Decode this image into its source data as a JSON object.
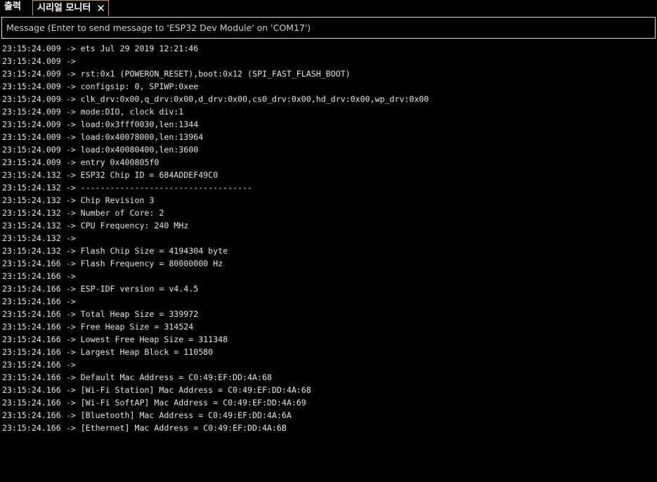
{
  "tabs": {
    "output_label": "출력",
    "serial_label": "시리얼 모니터",
    "close_glyph": "✕"
  },
  "message": {
    "placeholder": "Message (Enter to send message to 'ESP32 Dev Module' on 'COM17')"
  },
  "log_lines": [
    "23:15:24.009 -> ets Jul 29 2019 12:21:46",
    "23:15:24.009 -> ",
    "23:15:24.009 -> rst:0x1 (POWERON_RESET),boot:0x12 (SPI_FAST_FLASH_BOOT)",
    "23:15:24.009 -> configsip: 0, SPIWP:0xee",
    "23:15:24.009 -> clk_drv:0x00,q_drv:0x00,d_drv:0x00,cs0_drv:0x00,hd_drv:0x00,wp_drv:0x00",
    "23:15:24.009 -> mode:DIO, clock div:1",
    "23:15:24.009 -> load:0x3fff0030,len:1344",
    "23:15:24.009 -> load:0x40078000,len:13964",
    "23:15:24.009 -> load:0x40080400,len:3600",
    "23:15:24.009 -> entry 0x400805f0",
    "23:15:24.132 -> ESP32 Chip ID = 684ADDEF49C0",
    "23:15:24.132 -> -----------------------------------",
    "23:15:24.132 -> Chip Revision 3",
    "23:15:24.132 -> Number of Core: 2",
    "23:15:24.132 -> CPU Frequency: 240 MHz",
    "23:15:24.132 -> ",
    "23:15:24.132 -> Flash Chip Size = 4194304 byte",
    "23:15:24.166 -> Flash Frequency = 80000000 Hz",
    "23:15:24.166 -> ",
    "23:15:24.166 -> ESP-IDF version = v4.4.5",
    "23:15:24.166 -> ",
    "23:15:24.166 -> Total Heap Size = 339972",
    "23:15:24.166 -> Free Heap Size = 314524",
    "23:15:24.166 -> Lowest Free Heap Size = 311348",
    "23:15:24.166 -> Largest Heap Block = 110580",
    "23:15:24.166 -> ",
    "23:15:24.166 -> Default Mac Address = C0:49:EF:DD:4A:68",
    "23:15:24.166 -> [Wi-Fi Station] Mac Address = C0:49:EF:DD:4A:68",
    "23:15:24.166 -> [Wi-Fi SoftAP] Mac Address = C0:49:EF:DD:4A:69",
    "23:15:24.166 -> [Bluetooth] Mac Address = C0:49:EF:DD:4A:6A",
    "23:15:24.166 -> [Ethernet] Mac Address = C0:49:EF:DD:4A:6B"
  ]
}
